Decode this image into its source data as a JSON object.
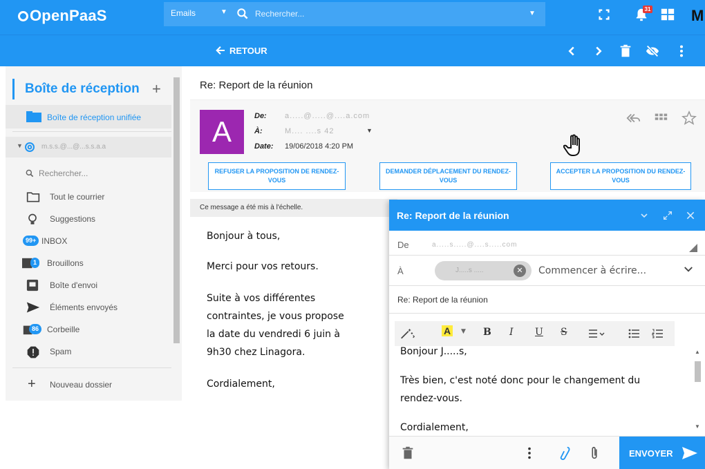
{
  "app": {
    "logo_text": "OpenPaaS",
    "user_initial": "M",
    "notifications_count": "31"
  },
  "search": {
    "scope": "Emails",
    "placeholder": "Rechercher..."
  },
  "subbar": {
    "back_label": "RETOUR"
  },
  "sidebar": {
    "title": "Boîte de réception",
    "unified_inbox": "Boîte de réception unifiée",
    "account": "m.s.s.@...@...s.s.a.a",
    "search_label": "Rechercher...",
    "items": [
      {
        "label": "Tout le courrier",
        "icon": "folder-icon"
      },
      {
        "label": "Suggestions",
        "icon": "lightbulb-icon"
      },
      {
        "label": "INBOX",
        "badge": "99+",
        "icon": "inbox-badge"
      },
      {
        "label": "Brouillons",
        "badge": "1",
        "icon": "drafts-icon"
      },
      {
        "label": "Boîte d'envoi",
        "icon": "outbox-icon"
      },
      {
        "label": "Éléments envoyés",
        "icon": "send-icon"
      },
      {
        "label": "Corbeille",
        "badge": "86",
        "icon": "trash-badge"
      },
      {
        "label": "Spam",
        "icon": "spam-icon"
      }
    ],
    "new_folder": "Nouveau dossier"
  },
  "message": {
    "subject": "Re: Report de la réunion",
    "avatar_letter": "A",
    "from_label": "De:",
    "from_value": "a.....@.....@....a.com",
    "to_label": "À:",
    "to_value": "M.... ....s 42",
    "date_label": "Date:",
    "date_value": "19/06/2018 4:20 PM",
    "invite_buttons": [
      {
        "label": "REFUSER LA PROPOSITION DE RENDEZ-VOUS"
      },
      {
        "label": "DEMANDER DÉPLACEMENT DU RENDEZ-VOUS"
      },
      {
        "label": "ACCEPTER LA PROPOSITION DU RENDEZ-VOUS"
      }
    ],
    "scaled_note": "Ce message a été mis à l'échelle.",
    "body": [
      "Bonjour à tous,",
      "Merci pour vos retours.",
      "Suite à vos différentes",
      "contraintes, je vous propose",
      "la date du vendredi 6 juin à",
      "9h30 chez Linagora.",
      "Cordialement,"
    ]
  },
  "composer": {
    "title": "Re: Report de la réunion",
    "from_label": "De",
    "from_value": "a.....s.....@....s.....com",
    "to_label": "À",
    "to_chip": "J.....s .....",
    "to_placeholder": "Commencer à écrire...",
    "subject": "Re: Report de la réunion",
    "body": [
      "Bonjour J.....s,",
      "Très bien, c'est noté donc pour le changement du",
      "rendez-vous.",
      "Cordialement,"
    ],
    "send_label": "ENVOYER",
    "toolbar": {
      "bold": "B",
      "italic": "I",
      "underline": "U",
      "strike": "S",
      "color": "A"
    }
  },
  "colors": {
    "primary": "#2196f3",
    "avatar": "#9c27b0",
    "badge_red": "#e53935"
  }
}
